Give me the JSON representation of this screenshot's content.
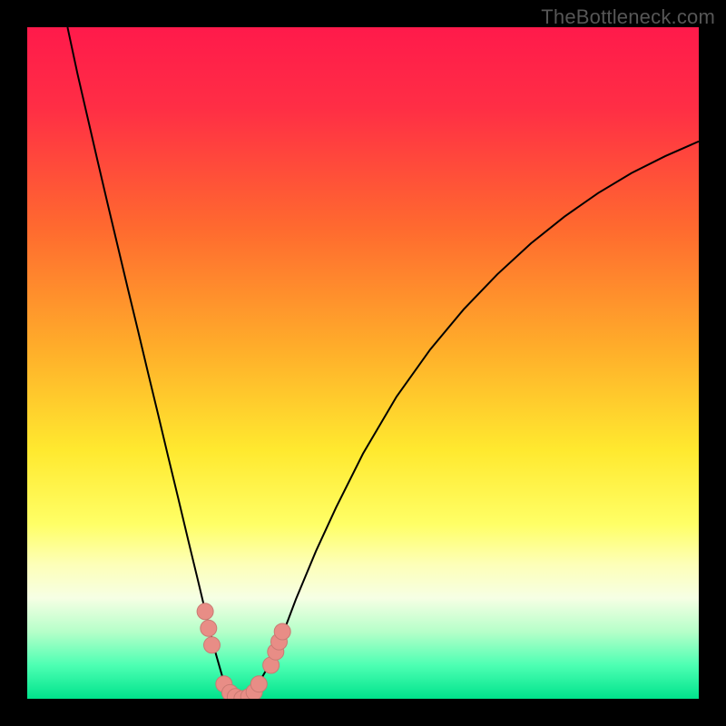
{
  "watermark": "TheBottleneck.com",
  "colors": {
    "frame": "#000000",
    "curve": "#000000",
    "marker_fill": "#e88d86",
    "marker_stroke": "#c97a73",
    "gradient_stops": [
      {
        "offset": 0.0,
        "color": "#ff1a4b"
      },
      {
        "offset": 0.12,
        "color": "#ff2e45"
      },
      {
        "offset": 0.3,
        "color": "#ff6a2f"
      },
      {
        "offset": 0.48,
        "color": "#ffae2a"
      },
      {
        "offset": 0.63,
        "color": "#ffe92f"
      },
      {
        "offset": 0.74,
        "color": "#ffff66"
      },
      {
        "offset": 0.8,
        "color": "#fdffb8"
      },
      {
        "offset": 0.85,
        "color": "#f6ffe4"
      },
      {
        "offset": 0.9,
        "color": "#b6ffc9"
      },
      {
        "offset": 0.95,
        "color": "#4dffb3"
      },
      {
        "offset": 1.0,
        "color": "#00e38c"
      }
    ]
  },
  "chart_data": {
    "type": "line",
    "title": "",
    "xlabel": "",
    "ylabel": "",
    "xlim": [
      0,
      100
    ],
    "ylim": [
      0,
      100
    ],
    "grid": false,
    "legend": false,
    "x": [
      6.0,
      7.5,
      9.0,
      10.5,
      12.0,
      13.5,
      15.0,
      16.5,
      18.0,
      19.5,
      21.0,
      22.5,
      24.0,
      25.5,
      27.0,
      28.0,
      29.0,
      30.0,
      31.0,
      32.0,
      33.0,
      34.0,
      36.0,
      38.0,
      40.0,
      43.0,
      46.0,
      50.0,
      55.0,
      60.0,
      65.0,
      70.0,
      75.0,
      80.0,
      85.0,
      90.0,
      95.0,
      100.0
    ],
    "values": [
      100.0,
      93.0,
      86.5,
      80.0,
      73.6,
      67.3,
      61.0,
      54.8,
      48.5,
      42.3,
      36.0,
      29.8,
      23.5,
      17.3,
      11.0,
      7.0,
      3.5,
      1.2,
      0.2,
      0.0,
      0.4,
      1.5,
      5.0,
      9.5,
      14.8,
      22.0,
      28.5,
      36.5,
      45.0,
      52.0,
      58.0,
      63.2,
      67.8,
      71.8,
      75.3,
      78.3,
      80.8,
      83.0
    ],
    "markers": [
      {
        "x": 26.5,
        "y": 13.0
      },
      {
        "x": 27.0,
        "y": 10.5
      },
      {
        "x": 27.5,
        "y": 8.0
      },
      {
        "x": 29.3,
        "y": 2.2
      },
      {
        "x": 30.2,
        "y": 0.9
      },
      {
        "x": 31.0,
        "y": 0.3
      },
      {
        "x": 32.0,
        "y": 0.0
      },
      {
        "x": 33.0,
        "y": 0.3
      },
      {
        "x": 33.8,
        "y": 1.0
      },
      {
        "x": 34.5,
        "y": 2.2
      },
      {
        "x": 36.3,
        "y": 5.0
      },
      {
        "x": 37.0,
        "y": 7.0
      },
      {
        "x": 37.5,
        "y": 8.5
      },
      {
        "x": 38.0,
        "y": 10.0
      }
    ]
  }
}
